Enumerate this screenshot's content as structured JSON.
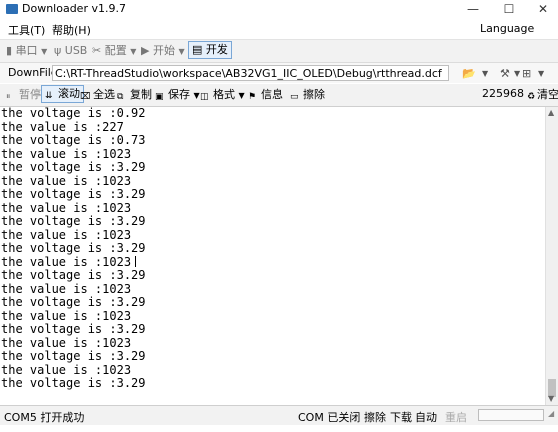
{
  "window": {
    "title": "Downloader v1.9.7",
    "minimize": "—",
    "maximize": "☐",
    "close": "✕"
  },
  "menu": {
    "tools": "工具(T)",
    "help": "帮助(H)",
    "language": "Language"
  },
  "toolbar1": {
    "serial": "串口",
    "usb": "USB",
    "config": "配置",
    "start": "开始",
    "develop": "开发"
  },
  "path": {
    "label": "DownFile",
    "value": "C:\\RT-ThreadStudio\\workspace\\AB32VG1_IIC_OLED\\Debug\\rtthread.dcf"
  },
  "toolbar2": {
    "pause": "暂停",
    "scroll": "滚动",
    "select_all": "全选",
    "copy": "复制",
    "save": "保存",
    "format": "格式",
    "info": "信息",
    "erase": "擦除",
    "count": "225968",
    "clear": "清空"
  },
  "console": {
    "lines": [
      "the voltage is :0.92",
      "the value is :227",
      "the voltage is :0.73",
      "the value is :1023",
      "the voltage is :3.29",
      "the value is :1023",
      "the voltage is :3.29",
      "the value is :1023",
      "the voltage is :3.29",
      "the value is :1023",
      "the voltage is :3.29",
      "the value is :1023",
      "the voltage is :3.29",
      "the value is :1023",
      "the voltage is :3.29",
      "the value is :1023",
      "the voltage is :3.29",
      "the value is :1023",
      "the voltage is :3.29",
      "the value is :1023",
      "the voltage is :3.29"
    ]
  },
  "status": {
    "port_open": "COM5 打开成功",
    "port_closed": "COM 已关闭",
    "erase": "擦除",
    "download": "下载",
    "auto": "自动",
    "restart": "重启"
  },
  "colors": {
    "accent": "#7aa7d6",
    "active_bg": "#e6f0fb"
  }
}
